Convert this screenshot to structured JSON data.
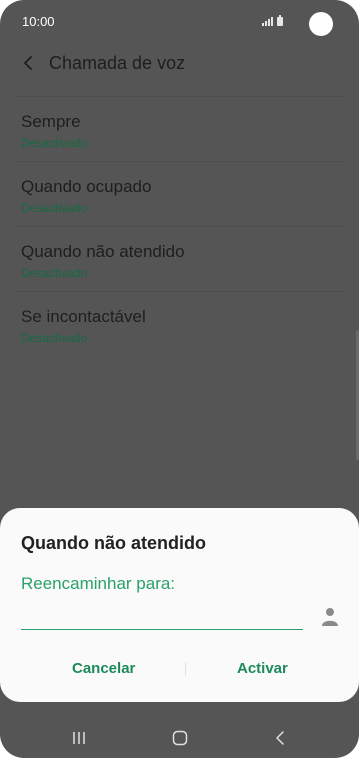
{
  "status_bar": {
    "time": "10:00"
  },
  "header": {
    "title": "Chamada de voz",
    "back_icon": "back-arrow-icon"
  },
  "settings": {
    "items": [
      {
        "label": "Sempre",
        "status": "Desactivado"
      },
      {
        "label": "Quando ocupado",
        "status": "Desactivado"
      },
      {
        "label": "Quando não atendido",
        "status": "Desactivado"
      },
      {
        "label": "Se incontactável",
        "status": "Desactivado"
      }
    ]
  },
  "dialog": {
    "title": "Quando não atendido",
    "field_label": "Reencaminhar para:",
    "input_value": "",
    "contact_icon": "contact-person-icon",
    "cancel_label": "Cancelar",
    "activate_label": "Activar"
  },
  "nav": {
    "recent_icon": "recent-apps-icon",
    "home_icon": "home-icon",
    "back_icon": "nav-back-icon"
  },
  "colors": {
    "dim_background": "#555555",
    "accent_green": "#2aa06b",
    "status_green": "#146b43",
    "dialog_bg": "#fafafa"
  }
}
